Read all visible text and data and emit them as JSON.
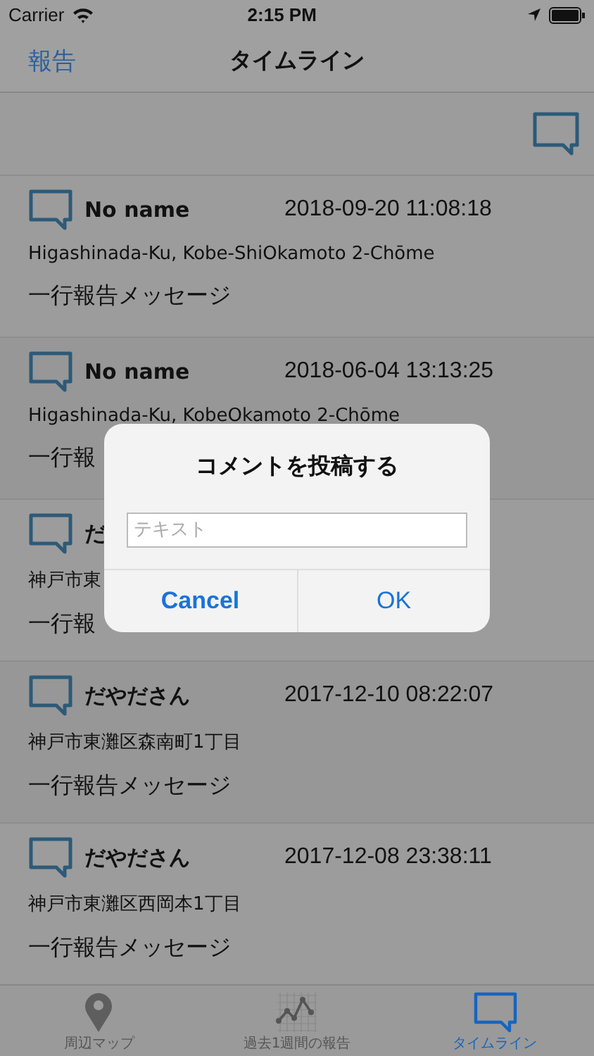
{
  "status_bar": {
    "carrier": "Carrier",
    "time": "2:15 PM"
  },
  "nav": {
    "back": "報告",
    "title": "タイムライン"
  },
  "posts": [
    {
      "name": "No name",
      "date": "2018-09-20 11:08:18",
      "address": "Higashinada-Ku, Kobe-ShiOkamoto 2-Chōme",
      "message": "一行報告メッセージ"
    },
    {
      "name": "No name",
      "date": "2018-06-04 13:13:25",
      "address": "Higashinada-Ku, KobeOkamoto 2-Chōme",
      "message": "一行報"
    },
    {
      "name": "だ",
      "address": "神戸市東",
      "message": "一行報"
    },
    {
      "name": "だやださん",
      "date": "2017-12-10 08:22:07",
      "address": "神戸市東灘区森南町1丁目",
      "message": "一行報告メッセージ"
    },
    {
      "name": "だやださん",
      "date": "2017-12-08 23:38:11",
      "address": "神戸市東灘区西岡本1丁目",
      "message": "一行報告メッセージ"
    }
  ],
  "dialog": {
    "title": "コメントを投稿する",
    "placeholder": "テキスト",
    "buttons": [
      {
        "label": "Cancel",
        "bold": true
      },
      {
        "label": "OK",
        "bold": false
      }
    ]
  },
  "tabs": [
    {
      "kind": "map",
      "label": "周辺マップ",
      "selected": false
    },
    {
      "kind": "chart",
      "label": "過去1週間の報告",
      "selected": false
    },
    {
      "kind": "timeline",
      "label": "タイムライン",
      "selected": true
    }
  ]
}
